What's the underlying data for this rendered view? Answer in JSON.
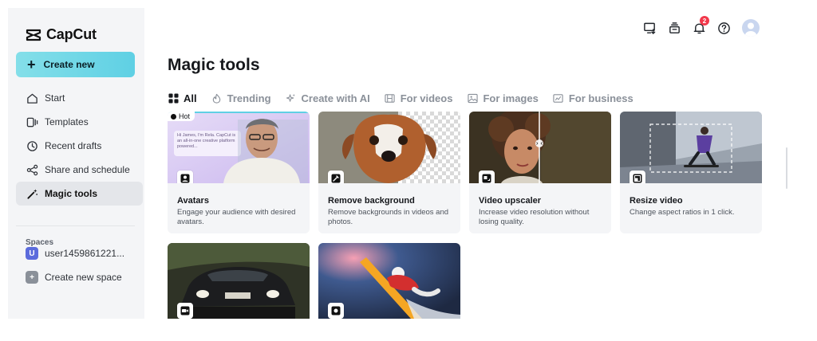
{
  "app": {
    "brand": "CapCut"
  },
  "sidebar": {
    "create_label": "Create new",
    "items": [
      {
        "label": "Start",
        "icon": "home-icon"
      },
      {
        "label": "Templates",
        "icon": "templates-icon"
      },
      {
        "label": "Recent drafts",
        "icon": "clock-icon"
      },
      {
        "label": "Share and schedule",
        "icon": "share-icon"
      },
      {
        "label": "Magic tools",
        "icon": "magic-wand-icon",
        "active": true
      }
    ],
    "spaces_heading": "Spaces",
    "spaces": [
      {
        "initial": "U",
        "label": "user1459861221...",
        "color": "#5b6bdc"
      },
      {
        "initial": "+",
        "label": "Create new space",
        "color": "#8a9099"
      }
    ]
  },
  "header": {
    "icons": [
      "device-icon",
      "inbox-icon",
      "bell-icon",
      "help-icon",
      "avatar"
    ],
    "notifications": "2"
  },
  "main": {
    "title": "Magic tools",
    "tabs": [
      {
        "label": "All",
        "icon": "grid-icon",
        "active": true
      },
      {
        "label": "Trending",
        "icon": "flame-icon"
      },
      {
        "label": "Create with AI",
        "icon": "sparkle-icon"
      },
      {
        "label": "For videos",
        "icon": "film-icon"
      },
      {
        "label": "For images",
        "icon": "image-icon"
      },
      {
        "label": "For business",
        "icon": "business-icon"
      }
    ],
    "hot_label": "Hot",
    "cards": [
      {
        "name": "Avatars",
        "desc": "Engage your audience with desired avatars."
      },
      {
        "name": "Remove background",
        "desc": "Remove backgrounds in videos and photos."
      },
      {
        "name": "Video upscaler",
        "desc": "Increase video resolution without losing quality."
      },
      {
        "name": "Resize video",
        "desc": "Change aspect ratios in 1 click."
      }
    ],
    "avatar_chat": "Hi James, I'm Rela. CapCut is an all-in-one creative platform powered..."
  },
  "colors": {
    "accent": "#5fd0e4",
    "badge": "#f2384b",
    "sidebar_bg": "#f4f5f7"
  }
}
